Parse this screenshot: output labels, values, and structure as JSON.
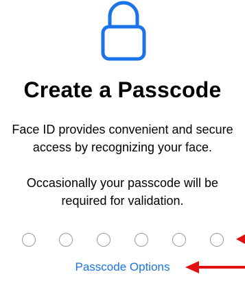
{
  "header": {
    "title": "Create a Passcode"
  },
  "body": {
    "description_1": "Face ID provides convenient and secure access by recognizing your face.",
    "description_2": "Occasionally your passcode will be required for validation."
  },
  "passcode": {
    "length": 6,
    "entered": 0
  },
  "actions": {
    "options_label": "Passcode Options"
  },
  "icons": {
    "lock": "lock-icon",
    "annotation": "red-arrow-icon"
  },
  "colors": {
    "accent": "#1a73e8",
    "dot_border": "#9a9a9e",
    "annotation": "#e01010"
  }
}
